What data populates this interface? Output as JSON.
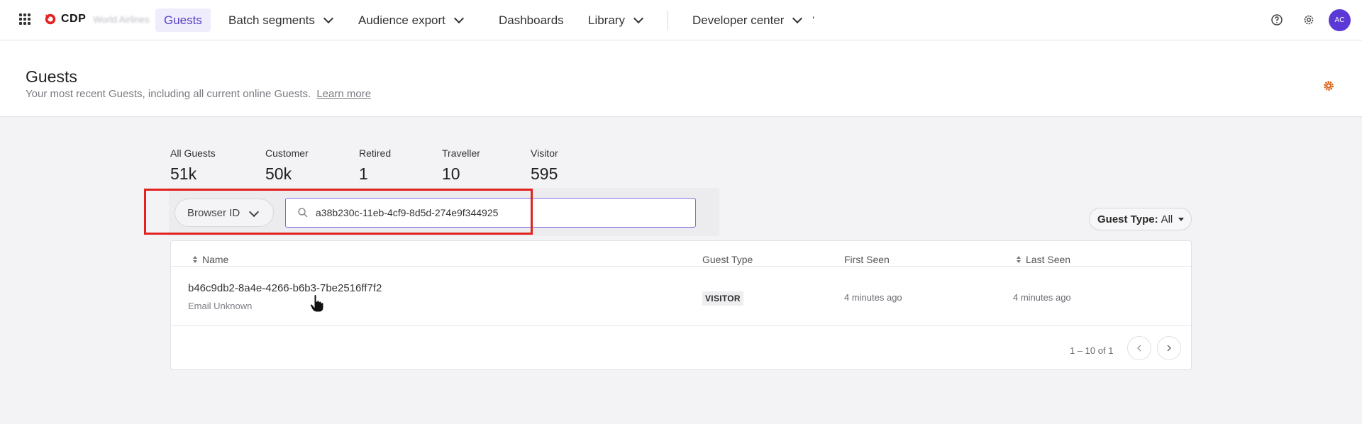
{
  "app": {
    "brand": "CDP",
    "org": "World Airlines",
    "accent": "#5a40c9"
  },
  "nav": {
    "items": [
      {
        "label": "Guests",
        "active": true
      },
      {
        "label": "Batch segments",
        "has_menu": true
      },
      {
        "label": "Audience export",
        "has_menu": true
      },
      {
        "label": "Dashboards"
      },
      {
        "label": "Library",
        "has_menu": true
      },
      {
        "label": "Developer center",
        "has_menu": true
      }
    ],
    "trailing_mark": "’",
    "avatar_initials": "AC",
    "icons": [
      "apps-grid-icon",
      "help-icon",
      "settings-icon"
    ]
  },
  "header": {
    "title": "Guests",
    "subtitle": "Your most recent Guests, including all current online Guests.",
    "learn_more": "Learn more"
  },
  "stats": [
    {
      "label": "All Guests",
      "value": "51k"
    },
    {
      "label": "Customer",
      "value": "50k"
    },
    {
      "label": "Retired",
      "value": "1"
    },
    {
      "label": "Traveller",
      "value": "10"
    },
    {
      "label": "Visitor",
      "value": "595"
    }
  ],
  "filter": {
    "field": "Browser ID",
    "search_value": "a38b230c-11eb-4cf9-8d5d-274e9f344925",
    "guest_type_label": "Guest Type:",
    "guest_type_value": "All"
  },
  "table": {
    "columns": [
      "Name",
      "Guest Type",
      "First Seen",
      "Last Seen"
    ],
    "rows": [
      {
        "name": "b46c9db2-8a4e-4266-b6b3-7be2516ff7f2",
        "email": "Email Unknown",
        "guest_type": "VISITOR",
        "first_seen": "4 minutes ago",
        "last_seen": "4 minutes ago"
      }
    ],
    "pagination": "1 – 10 of 1"
  }
}
